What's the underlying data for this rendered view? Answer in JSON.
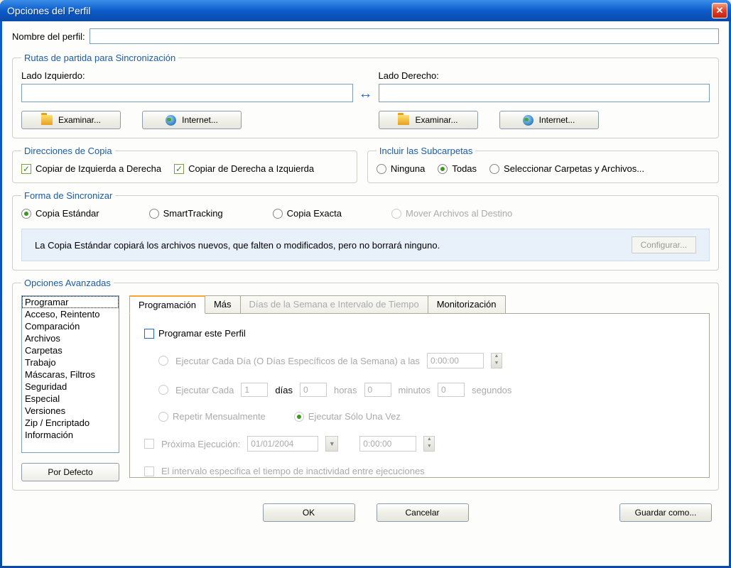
{
  "window": {
    "title": "Opciones del Perfil"
  },
  "profile": {
    "label": "Nombre del perfil:",
    "value": ""
  },
  "routes": {
    "legend": "Rutas de partida para Sincronización",
    "left_label": "Lado Izquierdo:",
    "right_label": "Lado Derecho:",
    "left_value": "",
    "right_value": "",
    "browse": "Examinar...",
    "internet": "Internet..."
  },
  "copydir": {
    "legend": "Direcciones de Copia",
    "ltr": "Copiar de Izquierda a Derecha",
    "rtl": "Copiar de Derecha a Izquierda"
  },
  "subfolders": {
    "legend": "Incluir las Subcarpetas",
    "none": "Ninguna",
    "all": "Todas",
    "select": "Seleccionar Carpetas y Archivos..."
  },
  "syncmode": {
    "legend": "Forma de Sincronizar",
    "standard": "Copia Estándar",
    "smart": "SmartTracking",
    "exact": "Copia Exacta",
    "move": "Mover Archivos al Destino",
    "desc": "La Copia Estándar copiará los archivos nuevos, que falten o modificados, pero no borrará ninguno.",
    "configure": "Configurar..."
  },
  "advanced": {
    "legend": "Opciones Avanzadas",
    "items": [
      "Programar",
      "Acceso, Reintento",
      "Comparación",
      "Archivos",
      "Carpetas",
      "Trabajo",
      "Máscaras, Filtros",
      "Seguridad",
      "Especial",
      "Versiones",
      "Zip / Encriptado",
      "Información"
    ],
    "default_btn": "Por Defecto"
  },
  "tabs": {
    "t1": "Programación",
    "t2": "Más",
    "t3": "Días de la Semana e Intervalo de Tiempo",
    "t4": "Monitorización"
  },
  "schedule": {
    "enable": "Programar este Perfil",
    "daily_pre": "Ejecutar Cada Día (O Días Específicos de la Semana) a las",
    "time1": "0:00:00",
    "every_pre": "Ejecutar Cada",
    "days_val": "1",
    "days_lbl": "días",
    "hours_val": "0",
    "hours_lbl": "horas",
    "mins_val": "0",
    "mins_lbl": "minutos",
    "secs_val": "0",
    "secs_lbl": "segundos",
    "monthly": "Repetir Mensualmente",
    "once": "Ejecutar Sólo Una Vez",
    "next_lbl": "Próxima Ejecución:",
    "next_date": "01/01/2004",
    "next_time": "0:00:00",
    "idle": "El intervalo especifica el tiempo de inactividad entre ejecuciones"
  },
  "footer": {
    "ok": "OK",
    "cancel": "Cancelar",
    "saveas": "Guardar como..."
  }
}
